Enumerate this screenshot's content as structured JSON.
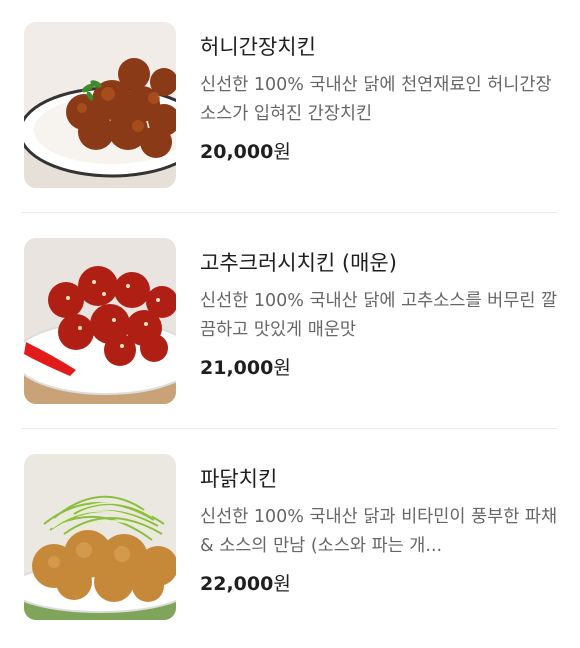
{
  "menu_items": [
    {
      "name": "허니간장치킨",
      "description": "신선한 100% 국내산 닭에 천연재료인 허니간장 소스가 입혀진 간장치킨",
      "price": "20,000",
      "currency": "원",
      "image_icon": "honey-soy-chicken-photo"
    },
    {
      "name": "고추크러시치킨 (매운)",
      "description": "신선한 100% 국내산 닭에 고추소스를 버무린 깔끔하고 맛있게 매운맛",
      "price": "21,000",
      "currency": "원",
      "image_icon": "spicy-pepper-chicken-photo"
    },
    {
      "name": "파닭치킨",
      "description": "신선한 100% 국내산 닭과 비타민이 풍부한 파채 & 소스의 만남 (소스와 파는 개...",
      "price": "22,000",
      "currency": "원",
      "image_icon": "green-onion-chicken-photo"
    }
  ]
}
